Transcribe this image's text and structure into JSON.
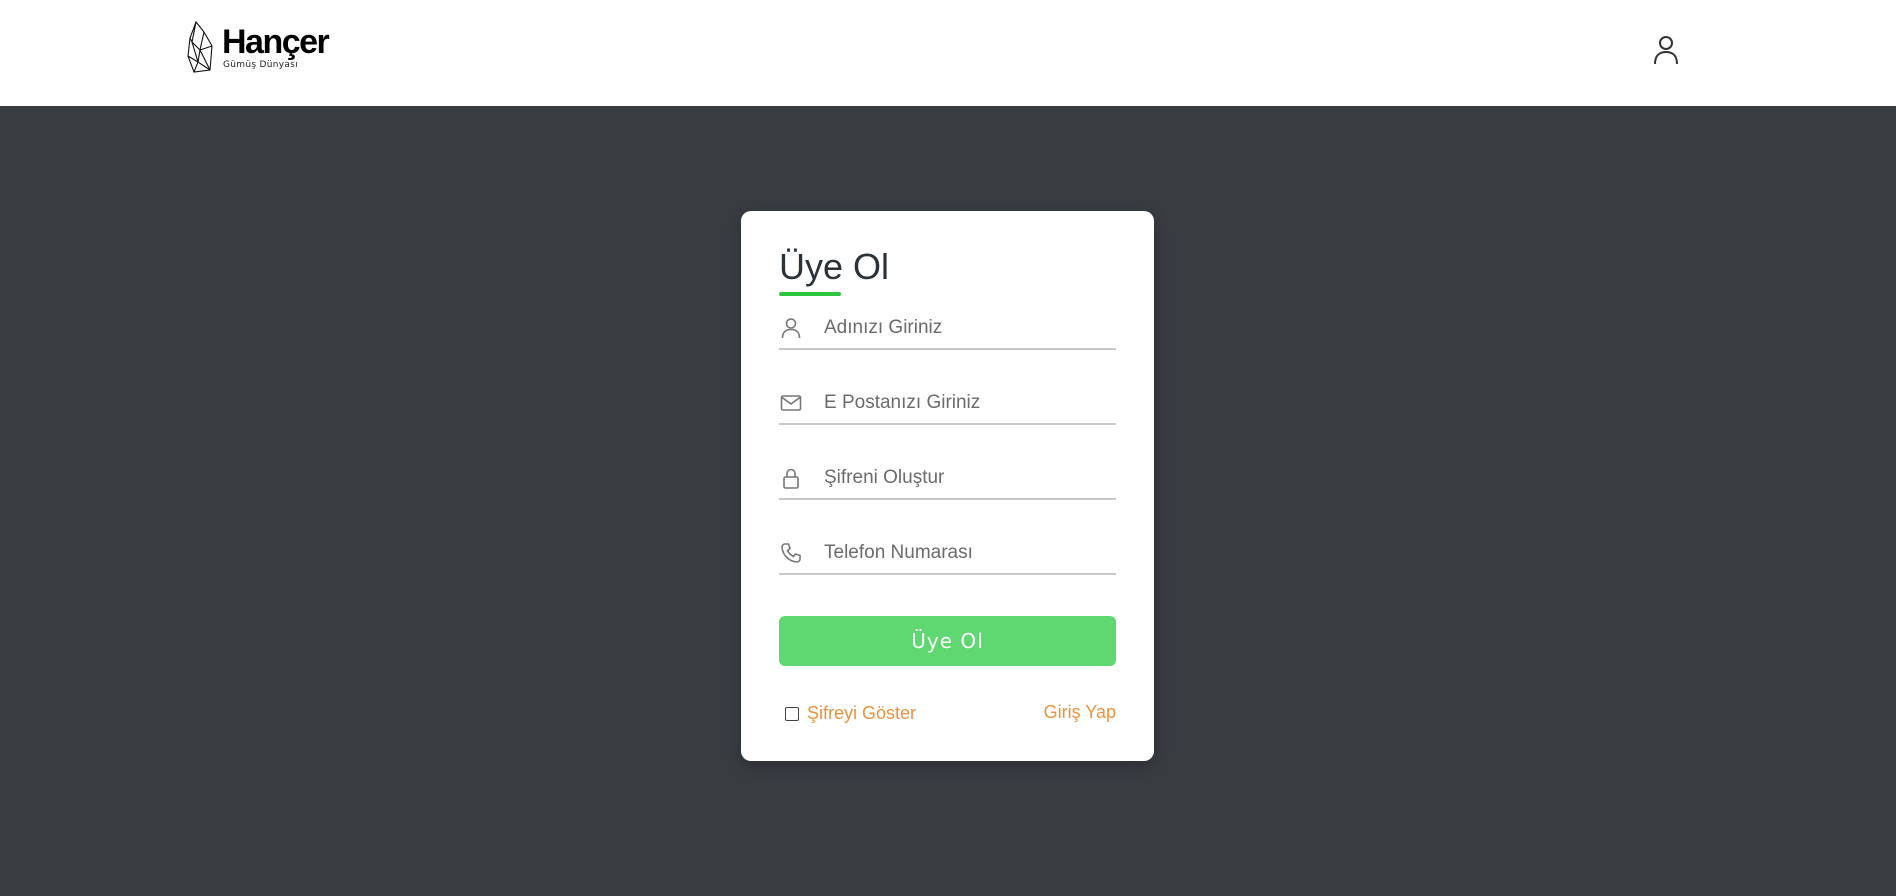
{
  "header": {
    "logo": {
      "title": "Hançer",
      "subtitle": "Gümüş Dünyası",
      "mark_icon": "crystal-logo-icon"
    },
    "account_icon": "user-icon"
  },
  "form": {
    "title": "Üye Ol",
    "accent_color": "#2ec540",
    "fields": [
      {
        "icon": "user-icon",
        "placeholder": "Adınızı Giriniz",
        "value": ""
      },
      {
        "icon": "mail-icon",
        "placeholder": "E Postanızı Giriniz",
        "value": ""
      },
      {
        "icon": "lock-icon",
        "placeholder": "Şifreni Oluştur",
        "value": ""
      },
      {
        "icon": "phone-icon",
        "placeholder": "Telefon Numarası",
        "value": ""
      }
    ],
    "submit_label": "Üye Ol",
    "submit_color": "#5fd872",
    "show_password_label": "Şifreyi Göster",
    "show_password_checked": false,
    "login_link": "Giriş Yap",
    "link_color": "#f0913a"
  },
  "colors": {
    "page_background": "#393d42",
    "header_background": "#ffffff"
  }
}
